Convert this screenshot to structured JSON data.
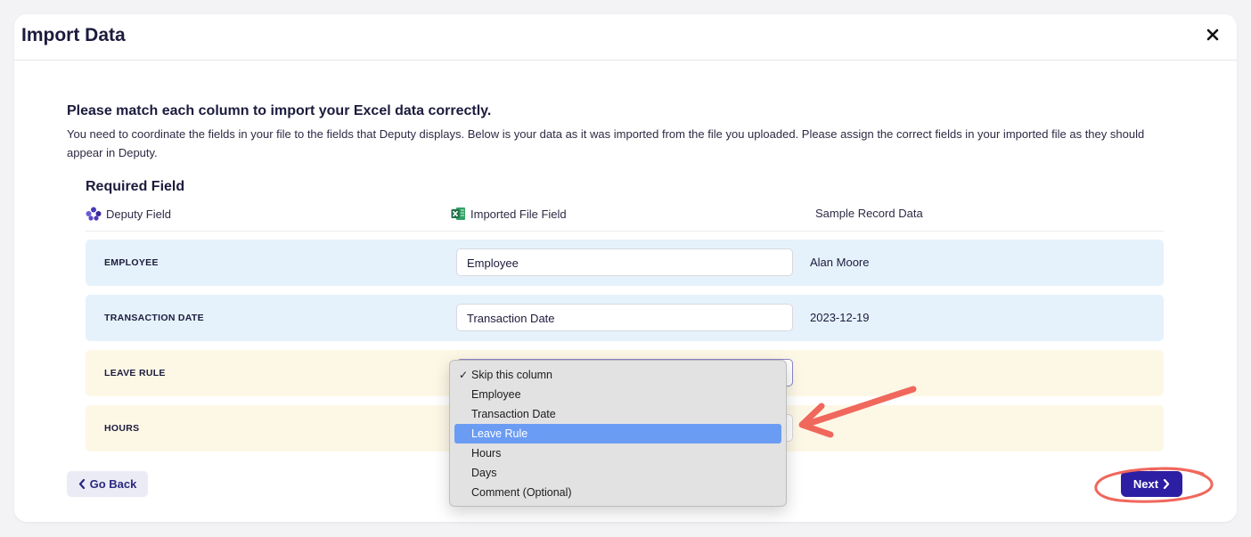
{
  "modal": {
    "title": "Import Data",
    "close_label": "close"
  },
  "intro": {
    "heading": "Please match each column to import your Excel data correctly.",
    "description": "You need to coordinate the fields in your file to the fields that Deputy displays. Below is your data as it was imported from the file you uploaded. Please assign the correct fields in your imported file as they should appear in Deputy."
  },
  "mapping": {
    "section_title": "Required Field",
    "columns": {
      "deputy_field": "Deputy Field",
      "imported_field": "Imported File Field",
      "sample_data": "Sample Record Data"
    },
    "rows": [
      {
        "label": "EMPLOYEE",
        "imported": "Employee",
        "sample": "Alan Moore",
        "tone": "blue"
      },
      {
        "label": "TRANSACTION DATE",
        "imported": "Transaction Date",
        "sample": "2023-12-19",
        "tone": "blue"
      },
      {
        "label": "LEAVE RULE",
        "imported": "",
        "sample": "",
        "tone": "yellow"
      },
      {
        "label": "HOURS",
        "imported": "",
        "sample": "",
        "tone": "yellow"
      }
    ]
  },
  "dropdown": {
    "options": [
      {
        "label": "Skip this column",
        "checked": true,
        "highlighted": false
      },
      {
        "label": "Employee",
        "checked": false,
        "highlighted": false
      },
      {
        "label": "Transaction Date",
        "checked": false,
        "highlighted": false
      },
      {
        "label": "Leave Rule",
        "checked": false,
        "highlighted": true
      },
      {
        "label": "Hours",
        "checked": false,
        "highlighted": false
      },
      {
        "label": "Days",
        "checked": false,
        "highlighted": false
      },
      {
        "label": "Comment (Optional)",
        "checked": false,
        "highlighted": false
      }
    ]
  },
  "footer": {
    "back_label": "Go Back",
    "next_label": "Next"
  },
  "colors": {
    "primary": "#2d1fa3",
    "required_row": "#e5f2fc",
    "unmapped_row": "#fdf7e6",
    "highlight": "#6b9cf4",
    "annotation": "#f0675c"
  }
}
